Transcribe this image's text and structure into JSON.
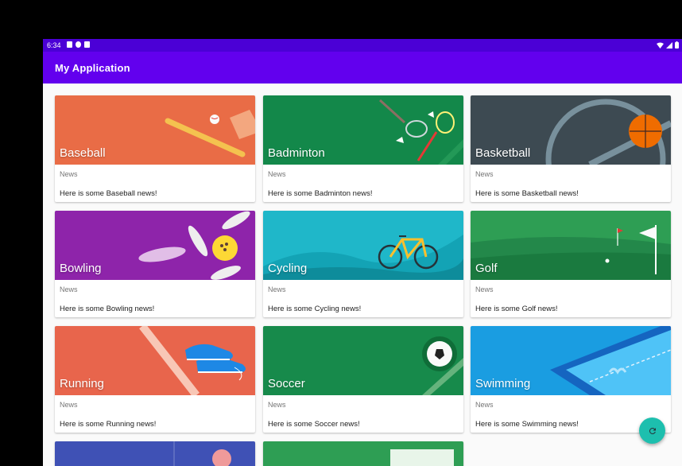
{
  "status_bar": {
    "time": "6:34"
  },
  "app_bar": {
    "title": "My Application"
  },
  "cards": [
    {
      "title": "Baseball",
      "subtitle": "News",
      "description": "Here is some Baseball news!",
      "color": "#e8654c"
    },
    {
      "title": "Badminton",
      "subtitle": "News",
      "description": "Here is some Badminton news!",
      "color": "#13884a"
    },
    {
      "title": "Basketball",
      "subtitle": "News",
      "description": "Here is some Basketball news!",
      "color": "#3d4a52"
    },
    {
      "title": "Bowling",
      "subtitle": "News",
      "description": "Here is some Bowling news!",
      "color": "#8e24aa"
    },
    {
      "title": "Cycling",
      "subtitle": "News",
      "description": "Here is some Cycling news!",
      "color": "#1fb7c9"
    },
    {
      "title": "Golf",
      "subtitle": "News",
      "description": "Here is some Golf news!",
      "color": "#2e9e54"
    },
    {
      "title": "Running",
      "subtitle": "News",
      "description": "Here is some Running news!",
      "color": "#e8654c"
    },
    {
      "title": "Soccer",
      "subtitle": "News",
      "description": "Here is some Soccer news!",
      "color": "#178a4b"
    },
    {
      "title": "Swimming",
      "subtitle": "News",
      "description": "Here is some Swimming news!",
      "color": "#1a9de1"
    }
  ],
  "fab": {
    "icon": "refresh-icon"
  }
}
